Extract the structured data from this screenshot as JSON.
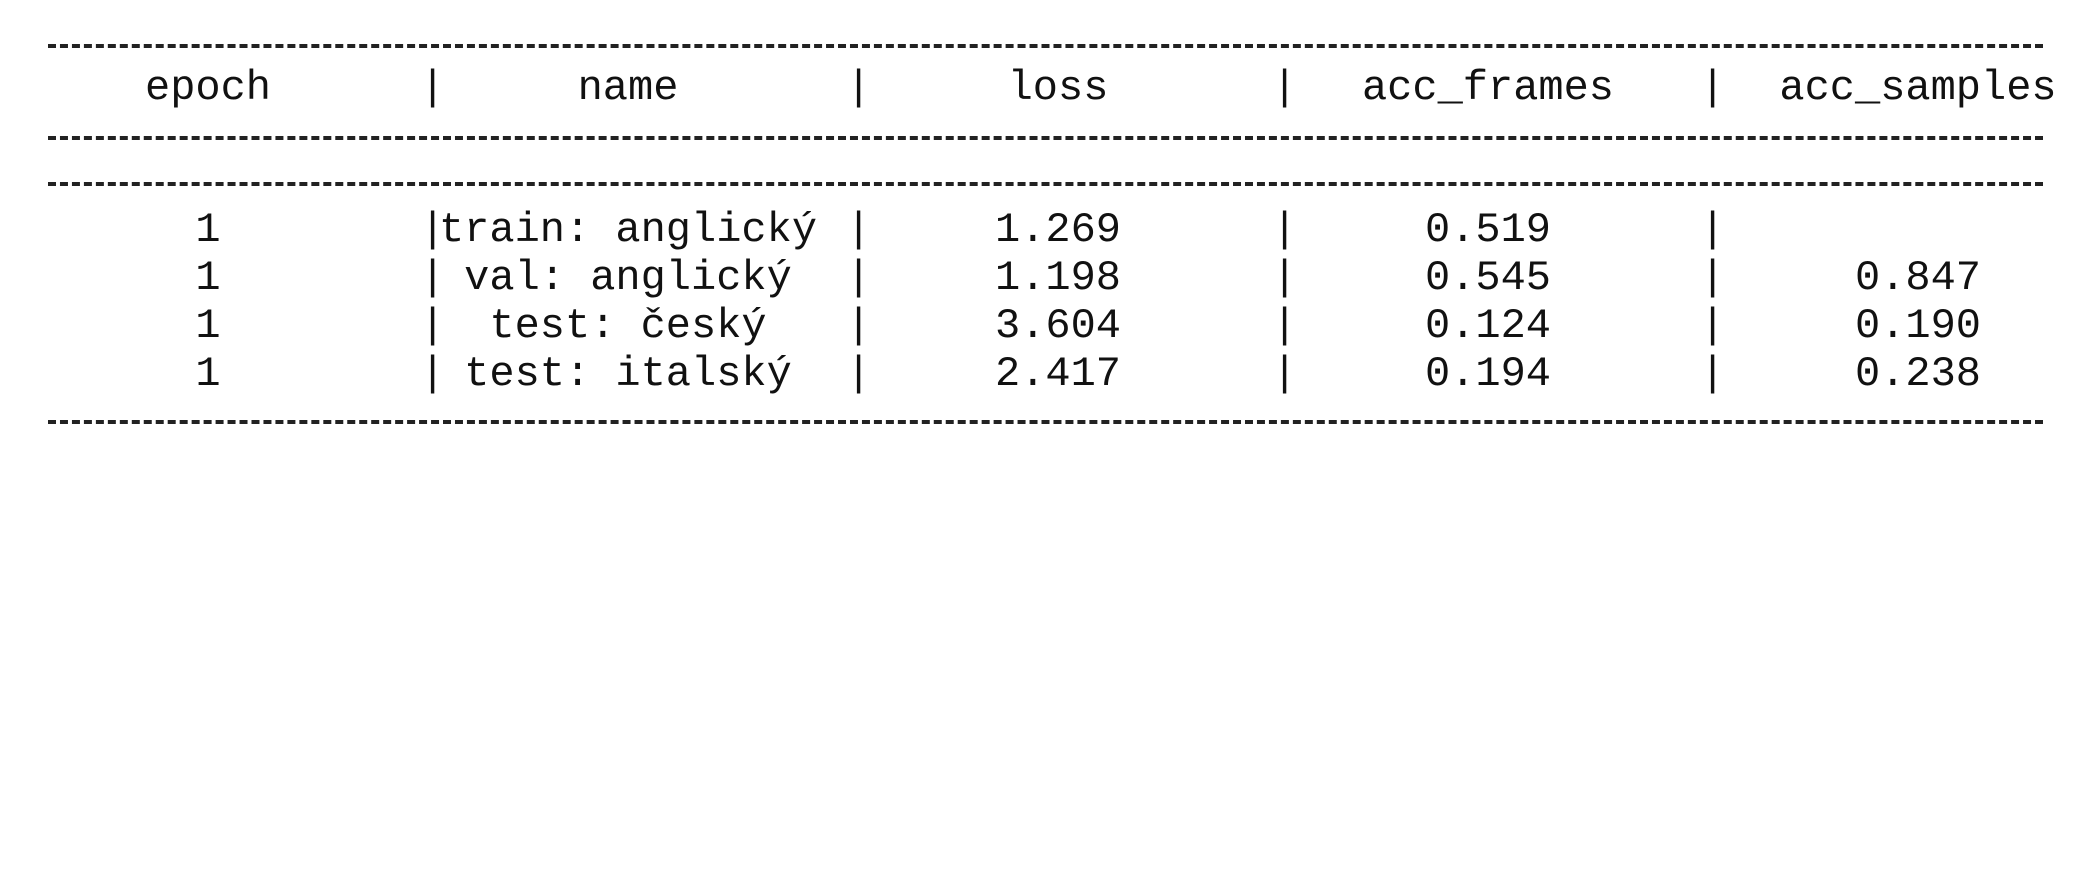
{
  "separator_char": "-",
  "bar_char": "|",
  "table": {
    "headers": {
      "epoch": "epoch",
      "name": "name",
      "loss": "loss",
      "acc_frames": "acc_frames",
      "acc_samples": "acc_samples"
    },
    "rows": [
      {
        "epoch": "1",
        "name": "train: anglický",
        "loss": "1.269",
        "acc_frames": "0.519",
        "acc_samples": ""
      },
      {
        "epoch": "1",
        "name": "val: anglický",
        "loss": "1.198",
        "acc_frames": "0.545",
        "acc_samples": "0.847"
      },
      {
        "epoch": "1",
        "name": "test: český",
        "loss": "3.604",
        "acc_frames": "0.124",
        "acc_samples": "0.190"
      },
      {
        "epoch": "1",
        "name": "test: italský",
        "loss": "2.417",
        "acc_frames": "0.194",
        "acc_samples": "0.238"
      }
    ]
  }
}
